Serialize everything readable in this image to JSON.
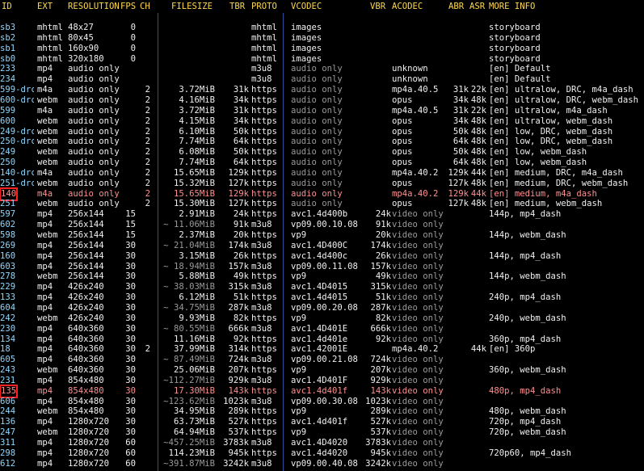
{
  "colors": {
    "background": "#000000",
    "header": "#ffd84d",
    "text": "#f0f0f0",
    "muted": "#9a9a9a",
    "id_color": "#8fd7ff",
    "selected": "#ff8f8f",
    "highlight_box": "#ff2020",
    "separator": "#2d4f9d"
  },
  "headers": {
    "id": "ID",
    "ext": "EXT",
    "resolution": "RESOLUTION",
    "fps": "FPS",
    "ch": "CH",
    "filesize": "FILESIZE",
    "tbr": "TBR",
    "proto": "PROTO",
    "vcodec": "VCODEC",
    "vbr": "VBR",
    "acodec": "ACODEC",
    "abr": "ABR",
    "asr": "ASR",
    "more": "MORE INFO"
  },
  "rows": [
    {
      "id": "sb3",
      "ext": "mhtml",
      "res": "48x27",
      "fps": "0",
      "ch": "",
      "size": "",
      "tbr": "",
      "proto": "mhtml",
      "vcodec": "images",
      "vbr": "",
      "acodec": "",
      "abr": "",
      "asr": "",
      "more": "storyboard"
    },
    {
      "id": "sb2",
      "ext": "mhtml",
      "res": "80x45",
      "fps": "0",
      "ch": "",
      "size": "",
      "tbr": "",
      "proto": "mhtml",
      "vcodec": "images",
      "vbr": "",
      "acodec": "",
      "abr": "",
      "asr": "",
      "more": "storyboard"
    },
    {
      "id": "sb1",
      "ext": "mhtml",
      "res": "160x90",
      "fps": "0",
      "ch": "",
      "size": "",
      "tbr": "",
      "proto": "mhtml",
      "vcodec": "images",
      "vbr": "",
      "acodec": "",
      "abr": "",
      "asr": "",
      "more": "storyboard"
    },
    {
      "id": "sb0",
      "ext": "mhtml",
      "res": "320x180",
      "fps": "0",
      "ch": "",
      "size": "",
      "tbr": "",
      "proto": "mhtml",
      "vcodec": "images",
      "vbr": "",
      "acodec": "",
      "abr": "",
      "asr": "",
      "more": "storyboard"
    },
    {
      "id": "233",
      "ext": "mp4",
      "res": "audio only",
      "fps": "",
      "ch": "",
      "size": "",
      "tbr": "",
      "proto": "m3u8",
      "vcodec": "audio only",
      "vbr": "",
      "acodec": "unknown",
      "abr": "",
      "asr": "",
      "more": "[en] Default"
    },
    {
      "id": "234",
      "ext": "mp4",
      "res": "audio only",
      "fps": "",
      "ch": "",
      "size": "",
      "tbr": "",
      "proto": "m3u8",
      "vcodec": "audio only",
      "vbr": "",
      "acodec": "unknown",
      "abr": "",
      "asr": "",
      "more": "[en] Default"
    },
    {
      "id": "599-drc",
      "ext": "m4a",
      "res": "audio only",
      "fps": "",
      "ch": "2",
      "size": "3.72MiB",
      "tbr": "31k",
      "proto": "https",
      "vcodec": "audio only",
      "vbr": "",
      "acodec": "mp4a.40.5",
      "abr": "31k",
      "asr": "22k",
      "more": "[en] ultralow, DRC, m4a_dash"
    },
    {
      "id": "600-drc",
      "ext": "webm",
      "res": "audio only",
      "fps": "",
      "ch": "2",
      "size": "4.16MiB",
      "tbr": "34k",
      "proto": "https",
      "vcodec": "audio only",
      "vbr": "",
      "acodec": "opus",
      "abr": "34k",
      "asr": "48k",
      "more": "[en] ultralow, DRC, webm_dash"
    },
    {
      "id": "599",
      "ext": "m4a",
      "res": "audio only",
      "fps": "",
      "ch": "2",
      "size": "3.72MiB",
      "tbr": "31k",
      "proto": "https",
      "vcodec": "audio only",
      "vbr": "",
      "acodec": "mp4a.40.5",
      "abr": "31k",
      "asr": "22k",
      "more": "[en] ultralow, m4a_dash"
    },
    {
      "id": "600",
      "ext": "webm",
      "res": "audio only",
      "fps": "",
      "ch": "2",
      "size": "4.15MiB",
      "tbr": "34k",
      "proto": "https",
      "vcodec": "audio only",
      "vbr": "",
      "acodec": "opus",
      "abr": "34k",
      "asr": "48k",
      "more": "[en] ultralow, webm_dash"
    },
    {
      "id": "249-drc",
      "ext": "webm",
      "res": "audio only",
      "fps": "",
      "ch": "2",
      "size": "6.10MiB",
      "tbr": "50k",
      "proto": "https",
      "vcodec": "audio only",
      "vbr": "",
      "acodec": "opus",
      "abr": "50k",
      "asr": "48k",
      "more": "[en] low, DRC, webm_dash"
    },
    {
      "id": "250-drc",
      "ext": "webm",
      "res": "audio only",
      "fps": "",
      "ch": "2",
      "size": "7.74MiB",
      "tbr": "64k",
      "proto": "https",
      "vcodec": "audio only",
      "vbr": "",
      "acodec": "opus",
      "abr": "64k",
      "asr": "48k",
      "more": "[en] low, DRC, webm_dash"
    },
    {
      "id": "249",
      "ext": "webm",
      "res": "audio only",
      "fps": "",
      "ch": "2",
      "size": "6.08MiB",
      "tbr": "50k",
      "proto": "https",
      "vcodec": "audio only",
      "vbr": "",
      "acodec": "opus",
      "abr": "50k",
      "asr": "48k",
      "more": "[en] low, webm_dash"
    },
    {
      "id": "250",
      "ext": "webm",
      "res": "audio only",
      "fps": "",
      "ch": "2",
      "size": "7.74MiB",
      "tbr": "64k",
      "proto": "https",
      "vcodec": "audio only",
      "vbr": "",
      "acodec": "opus",
      "abr": "64k",
      "asr": "48k",
      "more": "[en] low, webm_dash"
    },
    {
      "id": "140-drc",
      "ext": "m4a",
      "res": "audio only",
      "fps": "",
      "ch": "2",
      "size": "15.65MiB",
      "tbr": "129k",
      "proto": "https",
      "vcodec": "audio only",
      "vbr": "",
      "acodec": "mp4a.40.2",
      "abr": "129k",
      "asr": "44k",
      "more": "[en] medium, DRC, m4a_dash"
    },
    {
      "id": "251-drc",
      "ext": "webm",
      "res": "audio only",
      "fps": "",
      "ch": "2",
      "size": "15.32MiB",
      "tbr": "127k",
      "proto": "https",
      "vcodec": "audio only",
      "vbr": "",
      "acodec": "opus",
      "abr": "127k",
      "asr": "48k",
      "more": "[en] medium, DRC, webm_dash"
    },
    {
      "id": "140",
      "ext": "m4a",
      "res": "audio only",
      "fps": "",
      "ch": "2",
      "size": "15.65MiB",
      "tbr": "129k",
      "proto": "https",
      "vcodec": "audio only",
      "vbr": "",
      "acodec": "mp4a.40.2",
      "abr": "129k",
      "asr": "44k",
      "more": "[en] medium, m4a_dash",
      "selected": true
    },
    {
      "id": "251",
      "ext": "webm",
      "res": "audio only",
      "fps": "",
      "ch": "2",
      "size": "15.30MiB",
      "tbr": "127k",
      "proto": "https",
      "vcodec": "audio only",
      "vbr": "",
      "acodec": "opus",
      "abr": "127k",
      "asr": "48k",
      "more": "[en] medium, webm_dash"
    },
    {
      "id": "597",
      "ext": "mp4",
      "res": "256x144",
      "fps": "15",
      "ch": "",
      "size": "2.91MiB",
      "tbr": "24k",
      "proto": "https",
      "vcodec": "avc1.4d400b",
      "vbr": "24k",
      "acodec": "video only",
      "abr": "",
      "asr": "",
      "more": "144p, mp4_dash"
    },
    {
      "id": "602",
      "ext": "mp4",
      "res": "256x144",
      "fps": "15",
      "ch": "",
      "size": "~ 11.06MiB",
      "tbr": "91k",
      "proto": "m3u8",
      "vcodec": "vp09.00.10.08",
      "vbr": "91k",
      "acodec": "video only",
      "abr": "",
      "asr": "",
      "more": ""
    },
    {
      "id": "598",
      "ext": "webm",
      "res": "256x144",
      "fps": "15",
      "ch": "",
      "size": "2.37MiB",
      "tbr": "20k",
      "proto": "https",
      "vcodec": "vp9",
      "vbr": "20k",
      "acodec": "video only",
      "abr": "",
      "asr": "",
      "more": "144p, webm_dash"
    },
    {
      "id": "269",
      "ext": "mp4",
      "res": "256x144",
      "fps": "30",
      "ch": "",
      "size": "~ 21.04MiB",
      "tbr": "174k",
      "proto": "m3u8",
      "vcodec": "avc1.4D400C",
      "vbr": "174k",
      "acodec": "video only",
      "abr": "",
      "asr": "",
      "more": ""
    },
    {
      "id": "160",
      "ext": "mp4",
      "res": "256x144",
      "fps": "30",
      "ch": "",
      "size": "3.15MiB",
      "tbr": "26k",
      "proto": "https",
      "vcodec": "avc1.4d400c",
      "vbr": "26k",
      "acodec": "video only",
      "abr": "",
      "asr": "",
      "more": "144p, mp4_dash"
    },
    {
      "id": "603",
      "ext": "mp4",
      "res": "256x144",
      "fps": "30",
      "ch": "",
      "size": "~ 18.94MiB",
      "tbr": "157k",
      "proto": "m3u8",
      "vcodec": "vp09.00.11.08",
      "vbr": "157k",
      "acodec": "video only",
      "abr": "",
      "asr": "",
      "more": ""
    },
    {
      "id": "278",
      "ext": "webm",
      "res": "256x144",
      "fps": "30",
      "ch": "",
      "size": "5.88MiB",
      "tbr": "49k",
      "proto": "https",
      "vcodec": "vp9",
      "vbr": "49k",
      "acodec": "video only",
      "abr": "",
      "asr": "",
      "more": "144p, webm_dash"
    },
    {
      "id": "229",
      "ext": "mp4",
      "res": "426x240",
      "fps": "30",
      "ch": "",
      "size": "~ 38.03MiB",
      "tbr": "315k",
      "proto": "m3u8",
      "vcodec": "avc1.4D4015",
      "vbr": "315k",
      "acodec": "video only",
      "abr": "",
      "asr": "",
      "more": ""
    },
    {
      "id": "133",
      "ext": "mp4",
      "res": "426x240",
      "fps": "30",
      "ch": "",
      "size": "6.12MiB",
      "tbr": "51k",
      "proto": "https",
      "vcodec": "avc1.4d4015",
      "vbr": "51k",
      "acodec": "video only",
      "abr": "",
      "asr": "",
      "more": "240p, mp4_dash"
    },
    {
      "id": "604",
      "ext": "mp4",
      "res": "426x240",
      "fps": "30",
      "ch": "",
      "size": "~ 34.75MiB",
      "tbr": "287k",
      "proto": "m3u8",
      "vcodec": "vp09.00.20.08",
      "vbr": "287k",
      "acodec": "video only",
      "abr": "",
      "asr": "",
      "more": ""
    },
    {
      "id": "242",
      "ext": "webm",
      "res": "426x240",
      "fps": "30",
      "ch": "",
      "size": "9.93MiB",
      "tbr": "82k",
      "proto": "https",
      "vcodec": "vp9",
      "vbr": "82k",
      "acodec": "video only",
      "abr": "",
      "asr": "",
      "more": "240p, webm_dash"
    },
    {
      "id": "230",
      "ext": "mp4",
      "res": "640x360",
      "fps": "30",
      "ch": "",
      "size": "~ 80.55MiB",
      "tbr": "666k",
      "proto": "m3u8",
      "vcodec": "avc1.4D401E",
      "vbr": "666k",
      "acodec": "video only",
      "abr": "",
      "asr": "",
      "more": ""
    },
    {
      "id": "134",
      "ext": "mp4",
      "res": "640x360",
      "fps": "30",
      "ch": "",
      "size": "11.16MiB",
      "tbr": "92k",
      "proto": "https",
      "vcodec": "avc1.4d401e",
      "vbr": "92k",
      "acodec": "video only",
      "abr": "",
      "asr": "",
      "more": "360p, mp4_dash"
    },
    {
      "id": "18",
      "ext": "mp4",
      "res": "640x360",
      "fps": "30",
      "ch": "2",
      "size": "37.99MiB",
      "tbr": "314k",
      "proto": "https",
      "vcodec": "avc1.42001E",
      "vbr": "",
      "acodec": "mp4a.40.2",
      "abr": "",
      "asr": "44k",
      "more": "[en] 360p"
    },
    {
      "id": "605",
      "ext": "mp4",
      "res": "640x360",
      "fps": "30",
      "ch": "",
      "size": "~ 87.49MiB",
      "tbr": "724k",
      "proto": "m3u8",
      "vcodec": "vp09.00.21.08",
      "vbr": "724k",
      "acodec": "video only",
      "abr": "",
      "asr": "",
      "more": ""
    },
    {
      "id": "243",
      "ext": "webm",
      "res": "640x360",
      "fps": "30",
      "ch": "",
      "size": "25.06MiB",
      "tbr": "207k",
      "proto": "https",
      "vcodec": "vp9",
      "vbr": "207k",
      "acodec": "video only",
      "abr": "",
      "asr": "",
      "more": "360p, webm_dash"
    },
    {
      "id": "231",
      "ext": "mp4",
      "res": "854x480",
      "fps": "30",
      "ch": "",
      "size": "~112.27MiB",
      "tbr": "929k",
      "proto": "m3u8",
      "vcodec": "avc1.4D401F",
      "vbr": "929k",
      "acodec": "video only",
      "abr": "",
      "asr": "",
      "more": ""
    },
    {
      "id": "135",
      "ext": "mp4",
      "res": "854x480",
      "fps": "30",
      "ch": "",
      "size": "17.30MiB",
      "tbr": "143k",
      "proto": "https",
      "vcodec": "avc1.4d401f",
      "vbr": "143k",
      "acodec": "video only",
      "abr": "",
      "asr": "",
      "more": "480p, mp4_dash",
      "selected": true
    },
    {
      "id": "606",
      "ext": "mp4",
      "res": "854x480",
      "fps": "30",
      "ch": "",
      "size": "~123.62MiB",
      "tbr": "1023k",
      "proto": "m3u8",
      "vcodec": "vp09.00.30.08",
      "vbr": "1023k",
      "acodec": "video only",
      "abr": "",
      "asr": "",
      "more": ""
    },
    {
      "id": "244",
      "ext": "webm",
      "res": "854x480",
      "fps": "30",
      "ch": "",
      "size": "34.95MiB",
      "tbr": "289k",
      "proto": "https",
      "vcodec": "vp9",
      "vbr": "289k",
      "acodec": "video only",
      "abr": "",
      "asr": "",
      "more": "480p, webm_dash"
    },
    {
      "id": "136",
      "ext": "mp4",
      "res": "1280x720",
      "fps": "30",
      "ch": "",
      "size": "63.73MiB",
      "tbr": "527k",
      "proto": "https",
      "vcodec": "avc1.4d401f",
      "vbr": "527k",
      "acodec": "video only",
      "abr": "",
      "asr": "",
      "more": "720p, mp4_dash"
    },
    {
      "id": "247",
      "ext": "webm",
      "res": "1280x720",
      "fps": "30",
      "ch": "",
      "size": "64.94MiB",
      "tbr": "537k",
      "proto": "https",
      "vcodec": "vp9",
      "vbr": "537k",
      "acodec": "video only",
      "abr": "",
      "asr": "",
      "more": "720p, webm_dash"
    },
    {
      "id": "311",
      "ext": "mp4",
      "res": "1280x720",
      "fps": "60",
      "ch": "",
      "size": "~457.25MiB",
      "tbr": "3783k",
      "proto": "m3u8",
      "vcodec": "avc1.4D4020",
      "vbr": "3783k",
      "acodec": "video only",
      "abr": "",
      "asr": "",
      "more": ""
    },
    {
      "id": "298",
      "ext": "mp4",
      "res": "1280x720",
      "fps": "60",
      "ch": "",
      "size": "114.23MiB",
      "tbr": "945k",
      "proto": "https",
      "vcodec": "avc1.4d4020",
      "vbr": "945k",
      "acodec": "video only",
      "abr": "",
      "asr": "",
      "more": "720p60, mp4_dash"
    },
    {
      "id": "612",
      "ext": "mp4",
      "res": "1280x720",
      "fps": "60",
      "ch": "",
      "size": "~391.87MiB",
      "tbr": "3242k",
      "proto": "m3u8",
      "vcodec": "vp09.00.40.08",
      "vbr": "3242k",
      "acodec": "video only",
      "abr": "",
      "asr": "",
      "more": ""
    }
  ]
}
